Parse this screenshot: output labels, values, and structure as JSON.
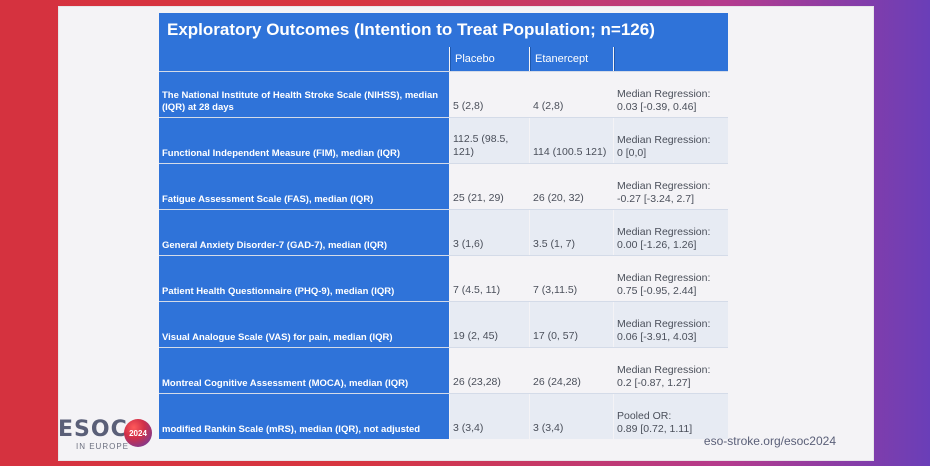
{
  "slide": {
    "title": "Exploratory Outcomes (Intention to Treat Population; n=126)",
    "columns": [
      "Placebo",
      "Etanercept",
      ""
    ],
    "rows": [
      {
        "label": "The National Institute of Health Stroke Scale (NIHSS), median (IQR) at 28 days",
        "placebo": "5 (2,8)",
        "etanercept": "4 (2,8)",
        "result_line1": "Median Regression:",
        "result_line2": "0.03 [-0.39, 0.46]"
      },
      {
        "label": "Functional Independent Measure (FIM), median (IQR)",
        "placebo": "112.5 (98.5, 121)",
        "etanercept": "114 (100.5 121)",
        "result_line1": "Median Regression:",
        "result_line2": "0 [0,0]"
      },
      {
        "label": "Fatigue Assessment Scale (FAS), median (IQR)",
        "placebo": "25 (21, 29)",
        "etanercept": "26 (20, 32)",
        "result_line1": "Median Regression:",
        "result_line2": "-0.27 [-3.24, 2.7]"
      },
      {
        "label": "General Anxiety Disorder-7 (GAD-7), median (IQR)",
        "placebo": "3 (1,6)",
        "etanercept": "3.5 (1, 7)",
        "result_line1": "Median Regression:",
        "result_line2": "0.00 [-1.26, 1.26]"
      },
      {
        "label": "Patient Health Questionnaire (PHQ-9), median (IQR)",
        "placebo": "7 (4.5, 11)",
        "etanercept": "7 (3,11.5)",
        "result_line1": "Median Regression:",
        "result_line2": "0.75 [-0.95, 2.44]"
      },
      {
        "label": "Visual Analogue Scale (VAS) for pain, median (IQR)",
        "placebo": "19 (2, 45)",
        "etanercept": "17 (0, 57)",
        "result_line1": "Median Regression:",
        "result_line2": "0.06 [-3.91, 4.03]"
      },
      {
        "label": "Montreal Cognitive Assessment (MOCA), median (IQR)",
        "placebo": "26 (23,28)",
        "etanercept": "26 (24,28)",
        "result_line1": "Median Regression:",
        "result_line2": "0.2 [-0.87, 1.27]"
      },
      {
        "label": "modified Rankin Scale (mRS), median (IQR), not adjusted",
        "placebo": "3 (3,4)",
        "etanercept": "3 (3,4)",
        "result_line1": "Pooled OR:",
        "result_line2": "0.89 [0.72, 1.11]"
      }
    ]
  },
  "branding": {
    "logo_text": "ESOC",
    "logo_year": "2024",
    "logo_subtitle": "IN EUROPE",
    "url": "eso-stroke.org/esoc2024"
  }
}
